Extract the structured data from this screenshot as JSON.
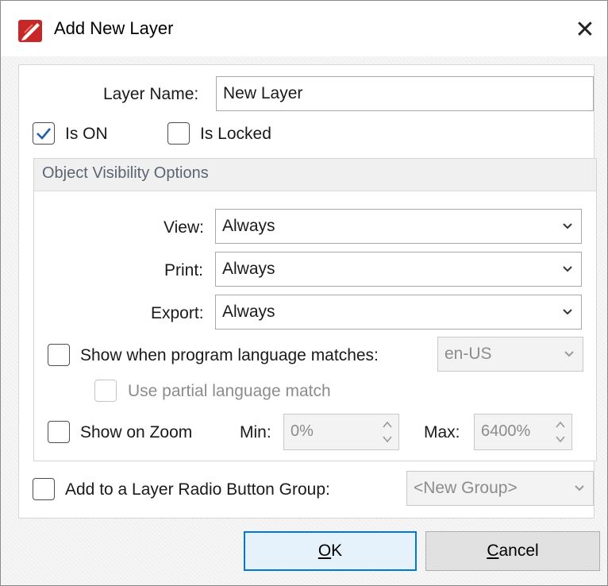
{
  "window": {
    "title": "Add New Layer",
    "close_glyph": "✕"
  },
  "layer_name": {
    "label": "Layer Name:",
    "value": "New Layer"
  },
  "is_on": {
    "label": "Is ON",
    "checked": true
  },
  "is_locked": {
    "label": "Is Locked",
    "checked": false
  },
  "visibility_group": {
    "title": "Object Visibility Options",
    "view": {
      "label": "View:",
      "value": "Always"
    },
    "print": {
      "label": "Print:",
      "value": "Always"
    },
    "export": {
      "label": "Export:",
      "value": "Always"
    },
    "language_match": {
      "label": "Show when program language matches:",
      "checked": false,
      "value": "en-US"
    },
    "partial_match": {
      "label": "Use partial language match",
      "checked": false,
      "enabled": false
    },
    "show_on_zoom": {
      "label": "Show on Zoom",
      "checked": false
    },
    "zoom_min": {
      "label": "Min:",
      "value": "0%"
    },
    "zoom_max": {
      "label": "Max:",
      "value": "6400%"
    }
  },
  "radio_group": {
    "label": "Add to a Layer Radio Button Group:",
    "checked": false,
    "value": "<New Group>"
  },
  "buttons": {
    "ok": {
      "mnemonic": "O",
      "rest": "K"
    },
    "cancel": {
      "mnemonic": "C",
      "rest": "ancel"
    }
  },
  "icons": {
    "app_logo": "pdf-editor-logo-icon",
    "accent": "#d0312d",
    "check": "#1e5fa8"
  }
}
